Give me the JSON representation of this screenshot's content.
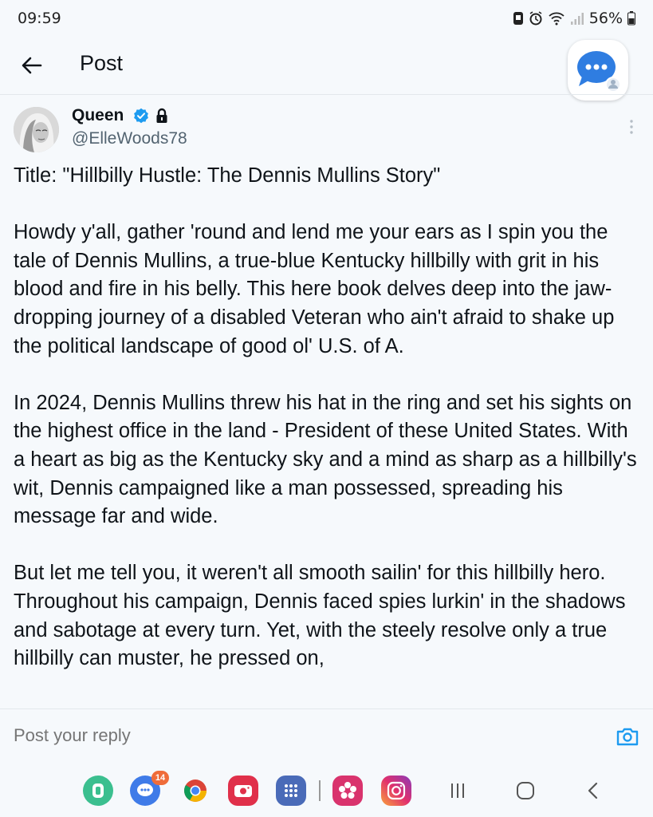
{
  "status_bar": {
    "time": "09:59",
    "battery": "56%"
  },
  "header": {
    "title": "Post",
    "back_icon": "arrow-left-icon",
    "chat_icon": "chat-bubble-icon"
  },
  "author": {
    "name": "Queen",
    "handle": "@ElleWoods78",
    "verified_icon": "verified-badge-icon",
    "lock_icon": "lock-icon"
  },
  "post": {
    "paragraphs": [
      "Title: \"Hillbilly Hustle: The Dennis Mullins Story\"",
      "Howdy y'all, gather 'round and lend me your ears as I spin you the tale of Dennis Mullins, a true-blue Kentucky hillbilly with grit in his blood and fire in his belly. This here book delves deep into the jaw-dropping journey of a disabled Veteran who ain't afraid to shake up the political landscape of good ol' U.S. of A.",
      "In 2024, Dennis Mullins threw his hat in the ring and set his sights on the highest office in the land - President of these United States. With a heart as big as the Kentucky sky and a mind as sharp as a hillbilly's wit, Dennis campaigned like a man possessed, spreading his message far and wide.",
      "But let me tell you, it weren't all smooth sailin' for this hillbilly hero. Throughout his campaign, Dennis faced spies lurkin' in the shadows and sabotage at every turn. Yet, with the steely resolve only a true hillbilly can muster, he pressed on,"
    ]
  },
  "reply": {
    "placeholder": "Post your reply"
  },
  "nav": {
    "messages_badge": "14"
  },
  "colors": {
    "accent": "#1d9bf0",
    "text_secondary": "#536471",
    "background": "#f6f9fc"
  }
}
